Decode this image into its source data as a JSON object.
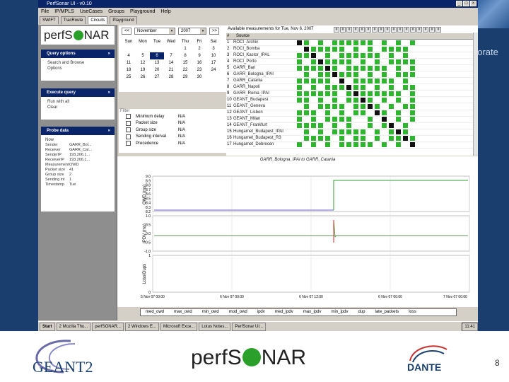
{
  "slide": {
    "side_text": "porate",
    "page_number": "8",
    "footer_logo_left": "GEANT2",
    "footer_logo_mid": "perfSONAR",
    "footer_logo_right": "DANTE"
  },
  "window": {
    "title": "PerfSonar UI - v0.10",
    "controls": [
      "_",
      "□",
      "×"
    ]
  },
  "menu": [
    "File",
    "IP/MPLS",
    "UseCases",
    "Groups",
    "Playground",
    "Help"
  ],
  "tabs": [
    "SWIFT",
    "TracRoute",
    "Circuits",
    "Playground"
  ],
  "left_panel": {
    "logo": {
      "pre": "perfS",
      "post": "NAR"
    },
    "query_options": {
      "title": "Query options",
      "body": [
        "Search and Browse",
        "Options"
      ]
    },
    "execute_query": {
      "title": "Execute query",
      "body": [
        "Run with all",
        "Clear"
      ]
    },
    "probe_data": {
      "title": "Probe data",
      "sub": "Now",
      "rows": [
        {
          "k": "Sender",
          "v": "GARR_Bol..."
        },
        {
          "k": "Receiver",
          "v": "GARR_Cat..."
        },
        {
          "k": "SenderIP",
          "v": "193.206.1..."
        },
        {
          "k": "ReceiverIP",
          "v": "193.206.1..."
        },
        {
          "k": "Measurement",
          "v": "OWD"
        },
        {
          "k": "Packet size",
          "v": "41"
        },
        {
          "k": "Group size",
          "v": "2"
        },
        {
          "k": "Sending int",
          "v": "1"
        },
        {
          "k": "Timestamp",
          "v": "Tue"
        }
      ]
    }
  },
  "calendar": {
    "month": "November",
    "year": "2007",
    "prev": "<<",
    "next": ">>",
    "weekdays": [
      "Sun",
      "Mon",
      "Tue",
      "Wed",
      "Thu",
      "Fri",
      "Sat"
    ],
    "weeks": [
      [
        "",
        "",
        "",
        "",
        "1",
        "2",
        "3"
      ],
      [
        "4",
        "5",
        "6",
        "7",
        "8",
        "9",
        "10"
      ],
      [
        "11",
        "12",
        "13",
        "14",
        "15",
        "16",
        "17"
      ],
      [
        "18",
        "19",
        "20",
        "21",
        "22",
        "23",
        "24"
      ],
      [
        "25",
        "26",
        "27",
        "28",
        "29",
        "30",
        ""
      ]
    ],
    "selected": "6"
  },
  "options": {
    "label": "Filter",
    "rows": [
      {
        "label": "Minimum delay",
        "value": "N/A"
      },
      {
        "label": "Packet size",
        "value": "N/A"
      },
      {
        "label": "Group size",
        "value": "N/A"
      },
      {
        "label": "Sending interval",
        "value": "N/A"
      },
      {
        "label": "Precedence",
        "value": "N/A"
      }
    ]
  },
  "events": {
    "title": "Available measurements for Tue, Nov 6, 2007",
    "headers": [
      "#",
      "Source"
    ],
    "rows": [
      {
        "n": "1",
        "src": "ROCI_Archiv"
      },
      {
        "n": "2",
        "src": "ROCI_Bomba"
      },
      {
        "n": "3",
        "src": "ROCI_Kastor_IPAL"
      },
      {
        "n": "4",
        "src": "ROCI_Porto"
      },
      {
        "n": "5",
        "src": "GARR_Bari"
      },
      {
        "n": "6",
        "src": "GARR_Bologna_IPAI"
      },
      {
        "n": "7",
        "src": "GARR_Catania"
      },
      {
        "n": "8",
        "src": "GARR_Napoli"
      },
      {
        "n": "9",
        "src": "GARR_Roma_IPAI"
      },
      {
        "n": "10",
        "src": "GEANT_Budapest"
      },
      {
        "n": "11",
        "src": "GEANT_Geneva"
      },
      {
        "n": "12",
        "src": "GEANT_Lisbon"
      },
      {
        "n": "13",
        "src": "GEANT_Milan"
      },
      {
        "n": "14",
        "src": "GEANT_Frankfurt"
      },
      {
        "n": "15",
        "src": "Hungarnet_Budapest_IPAI"
      },
      {
        "n": "16",
        "src": "Hungarnet_Budapest_R3"
      },
      {
        "n": "17",
        "src": "Hungarnet_Debrecen"
      }
    ],
    "cols": 17,
    "colors": {
      "on": "#2fb52f",
      "off": "#ffffff",
      "self": "#111111"
    }
  },
  "chart": {
    "title": "GARR_Bologna_IPAI to GARR_Catania",
    "panels": [
      {
        "ylabel": "OWD (ms)",
        "ticks": [
          "9.0",
          "8.9",
          "8.8",
          "8.7",
          "8.6",
          "8.5",
          "8.4",
          "8.3",
          "8.2"
        ]
      },
      {
        "ylabel": "IPDV (ms)",
        "ticks": [
          "1.0",
          "0.5",
          "0.0",
          "-0.5",
          "-1.0"
        ]
      },
      {
        "ylabel": "Loss/Dups",
        "ticks": [
          "1",
          "0"
        ]
      }
    ],
    "x_labels": [
      "5 Nov 07 00:00",
      "6 Nov 07 00:00",
      "6 Nov 07 12:00",
      "6 Nov 07 00:00",
      "7 Nov 07 00:00"
    ],
    "legend": [
      "med_owd",
      "max_owd",
      "min_owd",
      "mod_owd",
      "ipdv",
      "med_ipdv",
      "max_ipdv",
      "min_ipdv",
      "dup",
      "late_packets",
      "loss"
    ]
  },
  "taskbar": {
    "start": "Start",
    "items": [
      "2 Mozilla Thu...",
      "perfSONAR...",
      "2 Windows E...",
      "Microsoft Exce...",
      "Lotus Notes...",
      "PerfSonar UI..."
    ],
    "clock": "11:41"
  }
}
